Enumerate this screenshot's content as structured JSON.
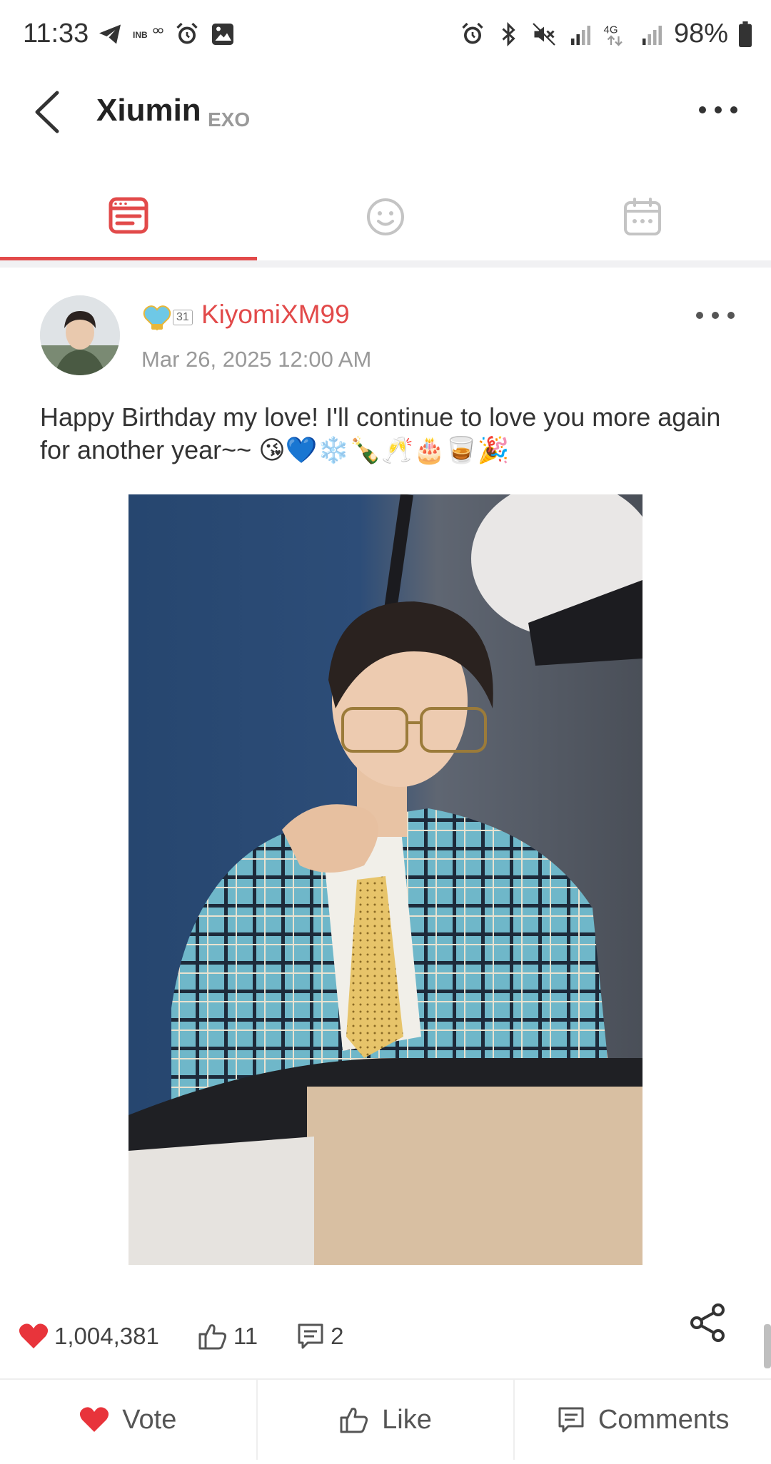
{
  "status_bar": {
    "time": "11:33",
    "battery": "98%",
    "left_icons": [
      "telegram-icon",
      "inb-icon",
      "alarm-icon",
      "gallery-icon"
    ],
    "right_icons": [
      "alarm-icon",
      "bluetooth-icon",
      "mute-icon",
      "signal-icon",
      "4g-icon",
      "signal-icon",
      "battery-icon"
    ],
    "inb_label": "INB",
    "network_label": "4G"
  },
  "header": {
    "title": "Xiumin",
    "subtitle": "EXO"
  },
  "tabs": [
    {
      "icon": "feed-icon",
      "active": true
    },
    {
      "icon": "smiley-icon",
      "active": false
    },
    {
      "icon": "calendar-icon",
      "active": false
    }
  ],
  "post": {
    "username": "KiyomiXM99",
    "badge_number": "31",
    "date": "Mar 26, 2025 12:00 AM",
    "text": "Happy Birthday my love! I'll continue to love you more again for another year~~",
    "emojis": "😘💙❄️🍾🥂🎂🥃🎉"
  },
  "stats": {
    "votes": "1,004,381",
    "likes": "11",
    "comments": "2"
  },
  "actions": {
    "vote": "Vote",
    "like": "Like",
    "comments": "Comments"
  },
  "colors": {
    "accent": "#e24a4a",
    "heart": "#e8343b"
  }
}
